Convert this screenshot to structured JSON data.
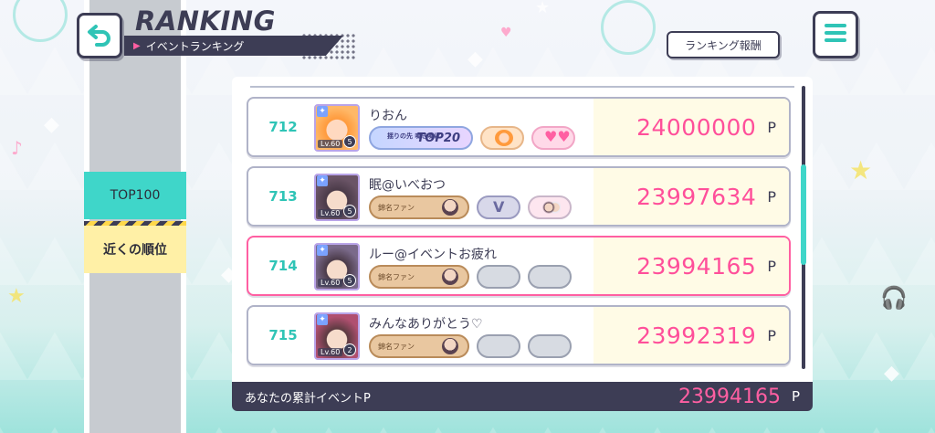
{
  "header": {
    "title": "RANKING",
    "subtitle": "イベントランキング",
    "reward_button": "ランキング報酬"
  },
  "sidebar": {
    "items": [
      {
        "label": "TOP100"
      },
      {
        "label": "近くの順位"
      }
    ]
  },
  "rows": [
    {
      "rank": "712",
      "name": "りおん",
      "level": "Lv.60",
      "master_rank": "5",
      "badge": {
        "title": "TOP20",
        "note": "揺りの先 鳴き鳴け"
      },
      "score": "24000000",
      "unit": "P",
      "highlighted": false
    },
    {
      "rank": "713",
      "name": "眠@いべおつ",
      "level": "Lv.60",
      "master_rank": "5",
      "badge": {
        "title": "錦名ファン"
      },
      "score": "23997634",
      "unit": "P",
      "highlighted": false
    },
    {
      "rank": "714",
      "name": "ルー@イベントお疲れ",
      "level": "Lv.60",
      "master_rank": "5",
      "badge": {
        "title": "錦名ファン"
      },
      "score": "23994165",
      "unit": "P",
      "highlighted": true
    },
    {
      "rank": "715",
      "name": "みんなありがとう♡",
      "level": "Lv.60",
      "master_rank": "2",
      "badge": {
        "title": "錦名ファン"
      },
      "score": "23992319",
      "unit": "P",
      "highlighted": false
    }
  ],
  "total": {
    "label": "あなたの累計イベントP",
    "value": "23994165",
    "unit": "P"
  },
  "colors": {
    "accent_pink": "#ff4f9a",
    "accent_teal": "#3fd6c9",
    "navy": "#3d3d55",
    "sidebar_gray": "#c7cbd0"
  }
}
